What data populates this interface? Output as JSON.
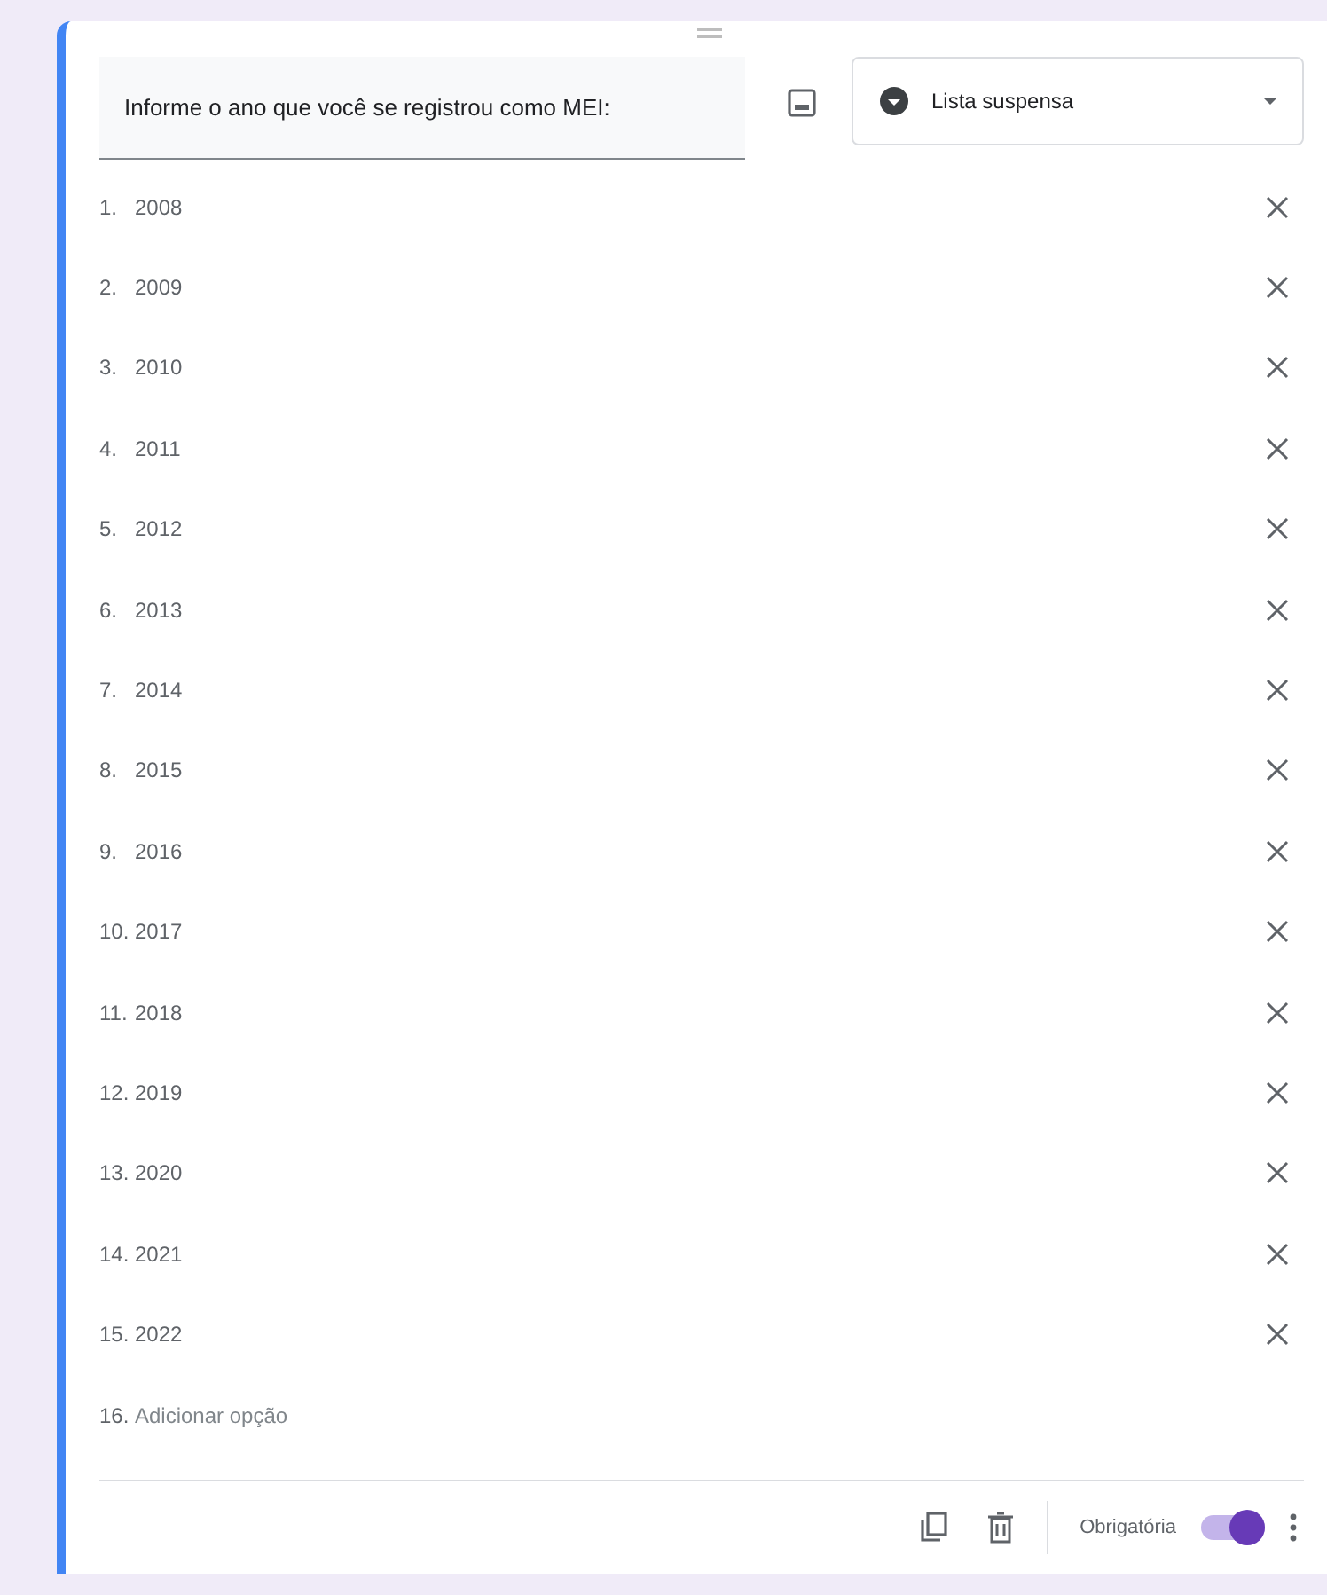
{
  "question": {
    "title": "Informe o ano que você se registrou como MEI:"
  },
  "type_select": {
    "label": "Lista suspensa"
  },
  "options": [
    {
      "number": "1.",
      "label": "2008"
    },
    {
      "number": "2.",
      "label": "2009"
    },
    {
      "number": "3.",
      "label": "2010"
    },
    {
      "number": "4.",
      "label": "2011"
    },
    {
      "number": "5.",
      "label": "2012"
    },
    {
      "number": "6.",
      "label": "2013"
    },
    {
      "number": "7.",
      "label": "2014"
    },
    {
      "number": "8.",
      "label": "2015"
    },
    {
      "number": "9.",
      "label": "2016"
    },
    {
      "number": "10.",
      "label": "2017"
    },
    {
      "number": "11.",
      "label": "2018"
    },
    {
      "number": "12.",
      "label": "2019"
    },
    {
      "number": "13.",
      "label": "2020"
    },
    {
      "number": "14.",
      "label": "2021"
    },
    {
      "number": "15.",
      "label": "2022"
    }
  ],
  "add_option": {
    "number": "16.",
    "label": "Adicionar opção"
  },
  "footer": {
    "required_label": "Obrigatória",
    "required": {
      "on": true
    }
  }
}
